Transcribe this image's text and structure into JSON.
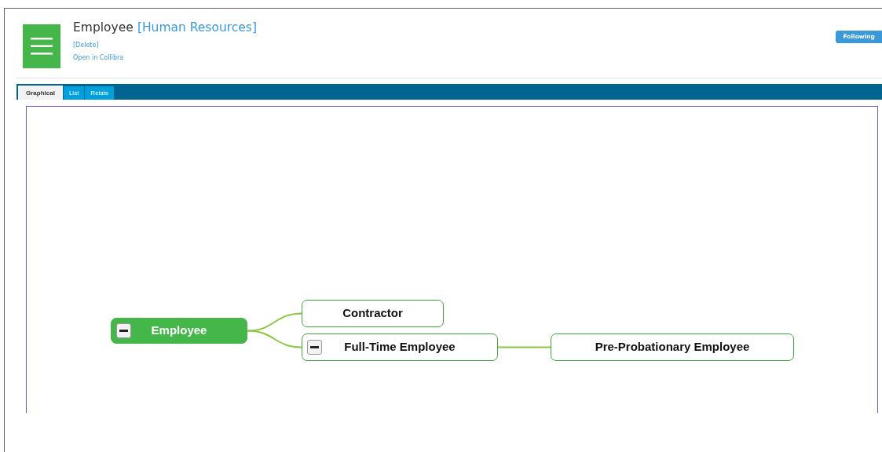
{
  "header": {
    "title": "Employee",
    "domain": "[Human Resources]",
    "links": [
      "[Delete]",
      "Open in Collibra"
    ],
    "follow_button": "Following"
  },
  "tabs": [
    {
      "label": "Graphical",
      "selected": true
    },
    {
      "label": "List",
      "selected": false
    },
    {
      "label": "Relate",
      "selected": false
    }
  ],
  "diagram": {
    "root": {
      "label": "Employee",
      "selected": true,
      "expanded": true,
      "children": [
        {
          "label": "Contractor",
          "selected": false
        },
        {
          "label": "Full-Time Employee",
          "selected": false,
          "expanded": true,
          "children": [
            {
              "label": "Pre-Probationary Employee",
              "selected": false
            }
          ]
        }
      ]
    }
  }
}
